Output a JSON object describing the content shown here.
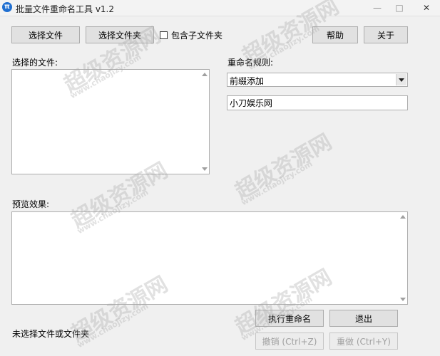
{
  "window": {
    "title": "批量文件重命名工具 v1.2",
    "icon_glyph": "π",
    "controls": {
      "minimize": "—",
      "maximize": "□",
      "close": "✕"
    }
  },
  "toolbar": {
    "select_files": "选择文件",
    "select_folder": "选择文件夹",
    "include_subfolders": "包含子文件夹",
    "include_subfolders_checked": false,
    "help": "帮助",
    "about": "关于"
  },
  "files": {
    "label": "选择的文件:",
    "items": []
  },
  "rename": {
    "label": "重命名规则:",
    "rule_selected": "前缀添加",
    "input_value": "小刀娱乐网"
  },
  "preview": {
    "label": "预览效果:",
    "items": []
  },
  "actions": {
    "execute": "执行重命名",
    "exit": "退出",
    "undo": "撤销 (Ctrl+Z)",
    "redo": "重做 (Ctrl+Y)"
  },
  "status": {
    "text": "未选择文件或文件夹"
  },
  "watermark": {
    "brand": "超级资源网",
    "url": "www.chaojizy.com"
  },
  "colors": {
    "window_bg": "#f0f0f0",
    "accent": "#0078d7",
    "app_icon": "#1f6fd1"
  }
}
